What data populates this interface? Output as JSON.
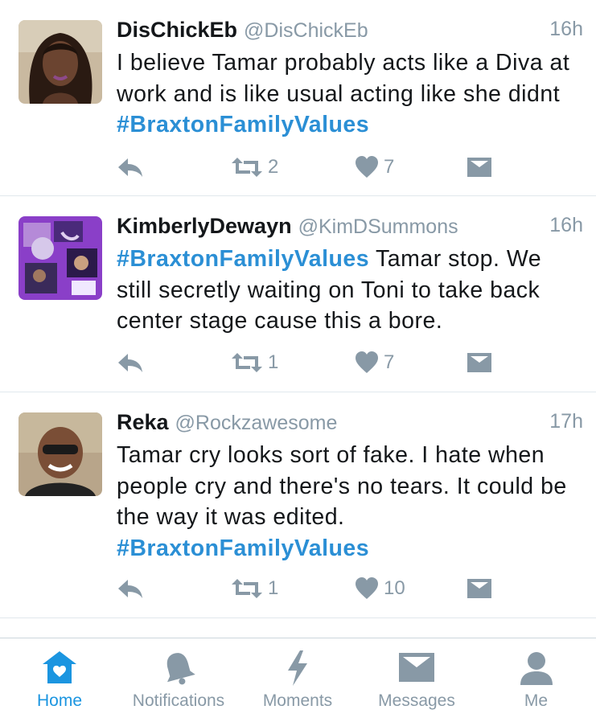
{
  "tweets": [
    {
      "name": "DisChickEb",
      "handle": "@DisChickEb",
      "time": "16h",
      "text_before": "I believe Tamar probably acts like a Diva at work and is like usual acting like she didnt ",
      "hashtag": "#BraxtonFamilyValues",
      "text_after": "",
      "retweets": "2",
      "likes": "7"
    },
    {
      "name": "KimberlyDewayn",
      "handle": "@KimDSummons",
      "time": "16h",
      "text_before": "",
      "hashtag": "#BraxtonFamilyValues",
      "text_after": " Tamar stop. We still secretly waiting on Toni to take back center stage cause this a bore.",
      "retweets": "1",
      "likes": "7"
    },
    {
      "name": "Reka",
      "handle": "@Rockzawesome",
      "time": "17h",
      "text_before": "Tamar cry looks sort of fake. I hate when people cry and there's no tears. It could be the way it was edited. ",
      "hashtag": "#BraxtonFamilyValues",
      "text_after": "",
      "retweets": "1",
      "likes": "10"
    }
  ],
  "tabbar": {
    "home": "Home",
    "notifications": "Notifications",
    "moments": "Moments",
    "messages": "Messages",
    "me": "Me"
  },
  "colors": {
    "accent": "#1b95e0",
    "hashtag": "#2b8fd5",
    "muted": "#8899a6",
    "divider": "#e1e8ed"
  }
}
